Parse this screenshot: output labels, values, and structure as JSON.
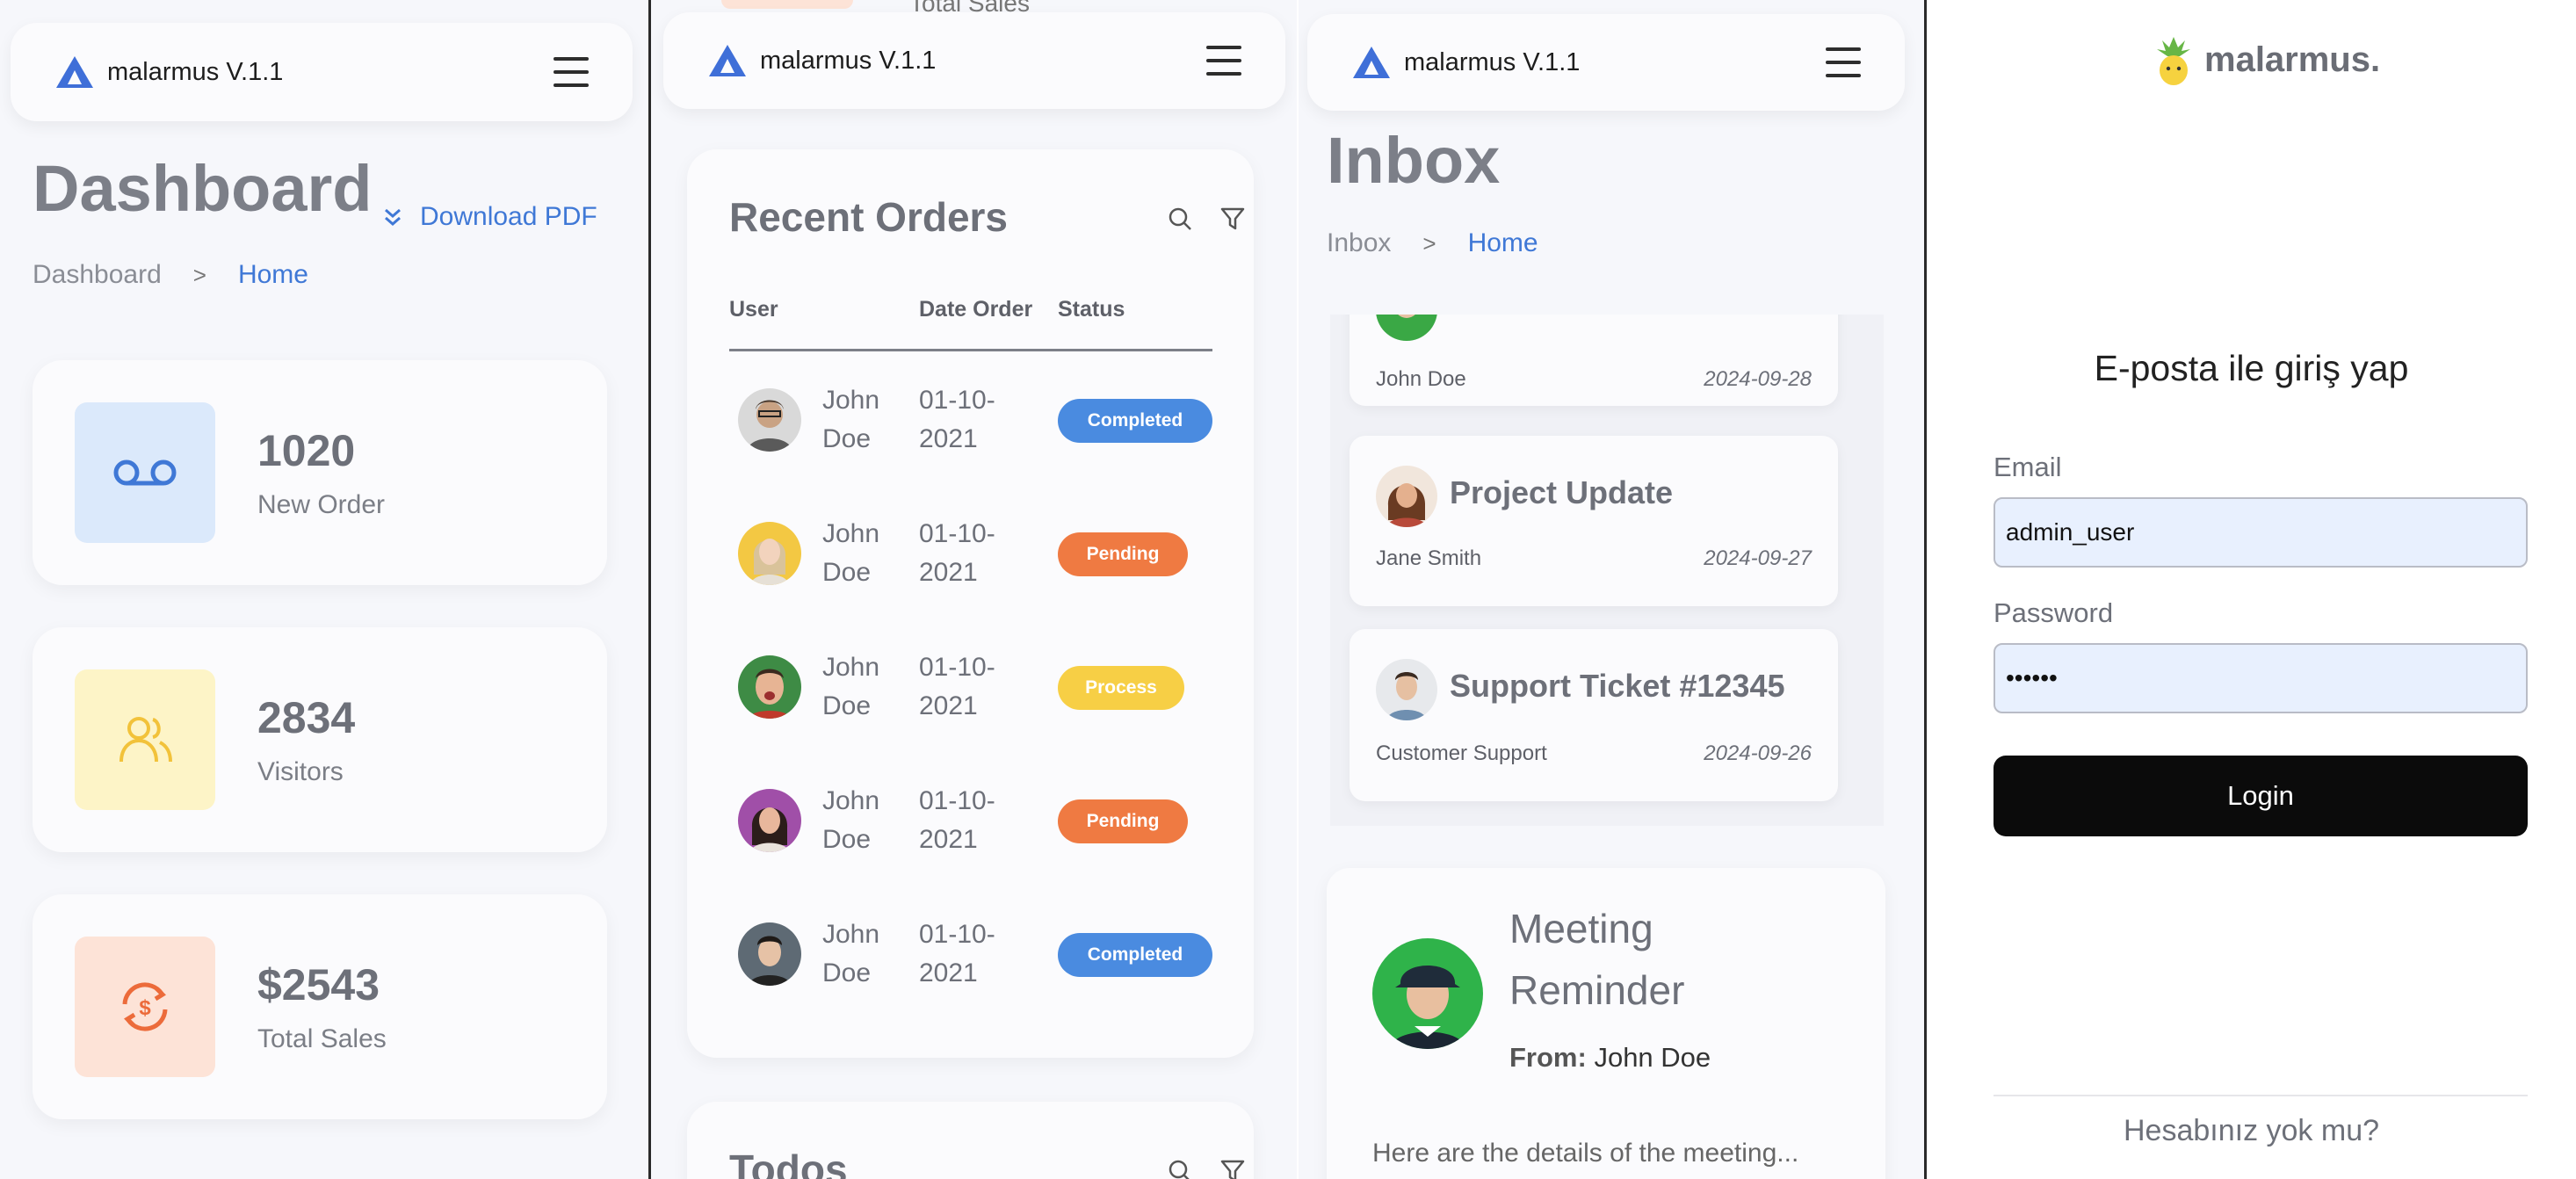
{
  "app": {
    "name": "malarmus V.1.1"
  },
  "dashboard": {
    "title": "Dashboard",
    "download_label": "Download PDF",
    "breadcrumb": {
      "parent": "Dashboard",
      "sep": ">",
      "current": "Home"
    },
    "stats": [
      {
        "value": "1020",
        "label": "New Order",
        "icon": "voicemail-icon",
        "bg": "#dbe9fb",
        "color": "#3f78d6"
      },
      {
        "value": "2834",
        "label": "Visitors",
        "icon": "users-icon",
        "bg": "#fdf4c7",
        "color": "#f2c23a"
      },
      {
        "value": "$2543",
        "label": "Total Sales",
        "icon": "dollar-cycle-icon",
        "bg": "#fde3d7",
        "color": "#ec6b3a"
      }
    ]
  },
  "orders": {
    "peek_label": "Total Sales",
    "title": "Recent Orders",
    "columns": [
      "User",
      "Date Order",
      "Status"
    ],
    "rows": [
      {
        "user": "John Doe",
        "date": "01-10-2021",
        "status": "Completed",
        "status_color": "#4a8be0"
      },
      {
        "user": "John Doe",
        "date": "01-10-2021",
        "status": "Pending",
        "status_color": "#ef7a42"
      },
      {
        "user": "John Doe",
        "date": "01-10-2021",
        "status": "Process",
        "status_color": "#f7cf45"
      },
      {
        "user": "John Doe",
        "date": "01-10-2021",
        "status": "Pending",
        "status_color": "#ef7a42"
      },
      {
        "user": "John Doe",
        "date": "01-10-2021",
        "status": "Completed",
        "status_color": "#4a8be0"
      }
    ],
    "todos_title": "Todos"
  },
  "inbox": {
    "title": "Inbox",
    "breadcrumb": {
      "parent": "Inbox",
      "sep": ">",
      "current": "Home"
    },
    "messages": [
      {
        "subject": "",
        "from": "John Doe",
        "date": "2024-09-28"
      },
      {
        "subject": "Project Update",
        "from": "Jane Smith",
        "date": "2024-09-27"
      },
      {
        "subject": "Support Ticket #12345",
        "from": "Customer Support",
        "date": "2024-09-26"
      }
    ],
    "reminder": {
      "title": "Meeting Reminder",
      "from_label": "From:",
      "from_name": "John Doe",
      "body": "Here are the details of the meeting..."
    }
  },
  "login": {
    "brand": "malarmus.",
    "heading": "E-posta ile giriş yap",
    "email_label": "Email",
    "email_value": "admin_user",
    "password_label": "Password",
    "password_value": "••••••",
    "button": "Login",
    "signup": "Hesabınız yok mu?"
  }
}
